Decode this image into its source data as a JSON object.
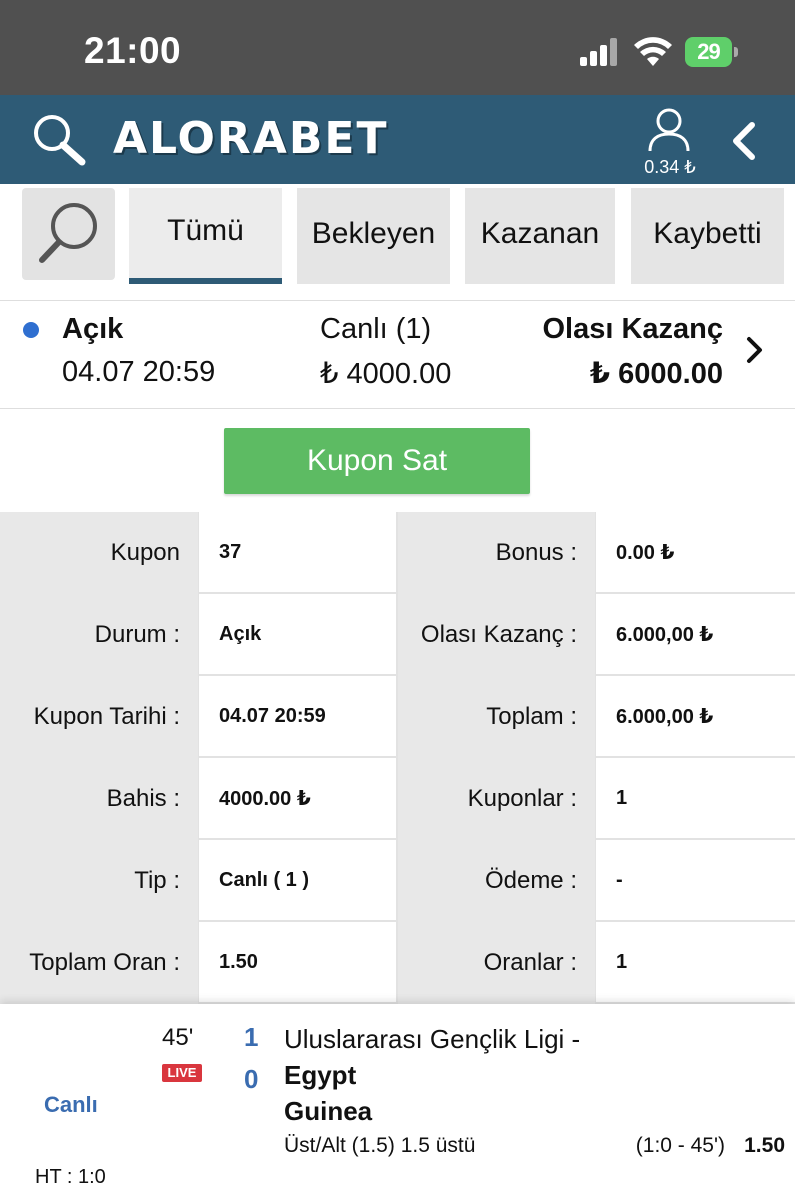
{
  "status_bar": {
    "time": "21:00",
    "battery": "29"
  },
  "header": {
    "logo": "ALORABET",
    "balance": "0.34 ₺",
    "icons": [
      "search-icon",
      "user-icon",
      "chevron-left-icon"
    ]
  },
  "tabs": {
    "items": [
      {
        "label": "Tümü",
        "active": true
      },
      {
        "label": "Bekleyen",
        "active": false
      },
      {
        "label": "Kazanan",
        "active": false
      },
      {
        "label": "Kaybetti",
        "active": false
      }
    ]
  },
  "summary": {
    "status": "Açık",
    "date": "04.07 20:59",
    "type": "Canlı (1)",
    "stake": "₺ 4000.00",
    "potential_label": "Olası Kazanç",
    "potential_value": "₺ 6000.00"
  },
  "sell_button": "Kupon Sat",
  "details": {
    "rows": [
      {
        "l1": "Kupon",
        "v1": "37",
        "l2": "Bonus :",
        "v2": "0.00 ₺"
      },
      {
        "l1": "Durum :",
        "v1": "Açık",
        "l2": "Olası Kazanç :",
        "v2": "6.000,00 ₺"
      },
      {
        "l1": "Kupon Tarihi :",
        "v1": "04.07 20:59",
        "l2": "Toplam :",
        "v2": "6.000,00 ₺"
      },
      {
        "l1": "Bahis :",
        "v1": "4000.00 ₺",
        "l2": "Kuponlar :",
        "v2": "1"
      },
      {
        "l1": "Tip :",
        "v1": "Canlı ( 1 )",
        "l2": "Ödeme :",
        "v2": "-"
      },
      {
        "l1": "Toplam Oran :",
        "v1": "1.50",
        "l2": "Oranlar :",
        "v2": "1"
      }
    ]
  },
  "bet": {
    "minute": "45'",
    "live_badge": "LIVE",
    "type": "Canlı",
    "score_home": "1",
    "score_away": "0",
    "league": "Uluslararası Gençlik Ligi -",
    "team_home": "Egypt",
    "team_away": "Guinea",
    "market": "Üst/Alt (1.5) 1.5 üstü",
    "time_info": "(1:0 - 45')",
    "odd": "1.50",
    "ht": "HT : 1:0"
  }
}
